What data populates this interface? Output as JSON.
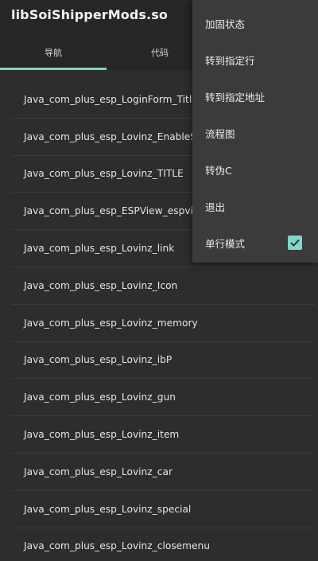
{
  "appbar": {
    "title": "libSoiShipperMods.so"
  },
  "tabs": [
    {
      "label": "导航",
      "selected": true
    },
    {
      "label": "代码",
      "selected": false
    }
  ],
  "list": {
    "items": [
      "Java_com_plus_esp_LoginForm_Title",
      "Java_com_plus_esp_Lovinz_EnableSou",
      "Java_com_plus_esp_Lovinz_TITLE",
      "Java_com_plus_esp_ESPView_espview",
      "Java_com_plus_esp_Lovinz_link",
      "Java_com_plus_esp_Lovinz_Icon",
      "Java_com_plus_esp_Lovinz_memory",
      "Java_com_plus_esp_Lovinz_ibP",
      "Java_com_plus_esp_Lovinz_gun",
      "Java_com_plus_esp_Lovinz_item",
      "Java_com_plus_esp_Lovinz_car",
      "Java_com_plus_esp_Lovinz_special",
      "Java_com_plus_esp_Lovinz_closemenu"
    ]
  },
  "menu": {
    "items": [
      {
        "label": "加固状态"
      },
      {
        "label": "转到指定行"
      },
      {
        "label": "转到指定地址"
      },
      {
        "label": "流程图"
      },
      {
        "label": "转伪C"
      },
      {
        "label": "退出"
      },
      {
        "label": "单行模式",
        "checked": true
      }
    ]
  },
  "colors": {
    "background": "#2d2d2d",
    "appbar": "#262626",
    "accent": "#7fd3c2",
    "menu": "#3b3b3b"
  }
}
